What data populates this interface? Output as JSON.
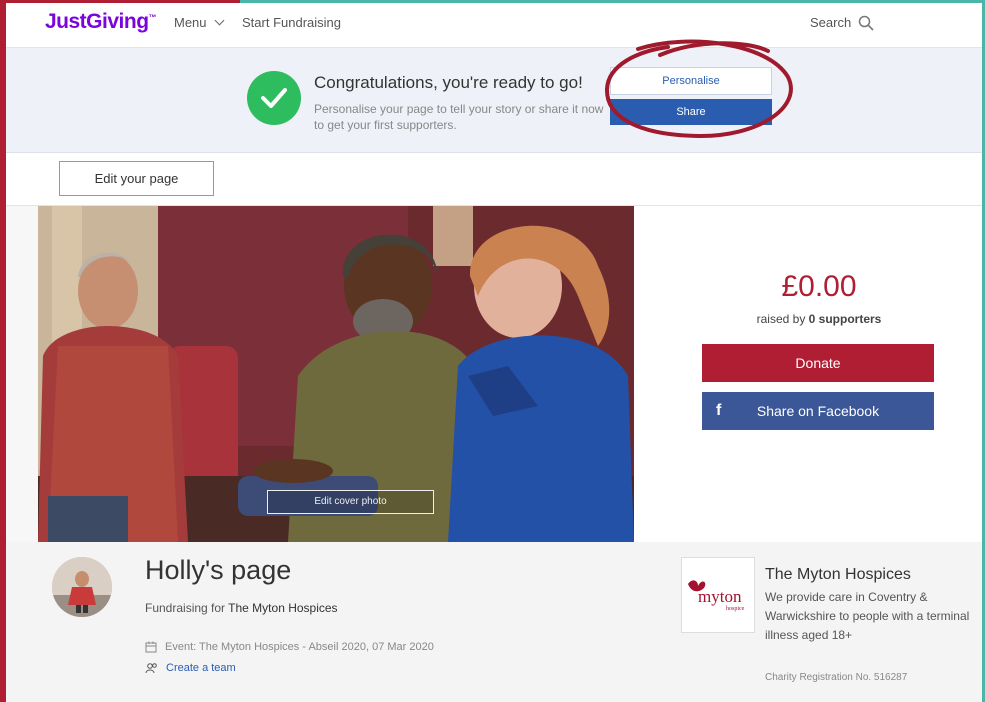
{
  "header": {
    "logo": "JustGiving",
    "menu_label": "Menu",
    "start_fundraising": "Start Fundraising",
    "search_label": "Search"
  },
  "banner": {
    "title": "Congratulations, you're ready to go!",
    "subtitle_line1": "Personalise your page to tell your story or share it now",
    "subtitle_line2": "to get your first supporters.",
    "personalise_label": "Personalise",
    "share_label": "Share"
  },
  "edit": {
    "edit_page_label": "Edit your page",
    "edit_cover_label": "Edit cover photo"
  },
  "fundraising": {
    "amount": "£0.00",
    "raised_by_prefix": "raised by",
    "supporters": "0 supporters",
    "donate_label": "Donate",
    "facebook_label": "Share on Facebook",
    "facebook_icon": "f"
  },
  "page": {
    "title": "Holly's page",
    "fundraising_for_prefix": "Fundraising for",
    "charity_link": "The Myton Hospices",
    "event": "Event: The Myton Hospices - Abseil 2020, 07 Mar 2020",
    "create_team": "Create a team"
  },
  "charity": {
    "name": "The Myton Hospices",
    "description": "We provide care in Coventry & Warwickshire to people with a terminal illness aged 18+",
    "registration": "Charity Registration No. 516287",
    "logo_text": "myton",
    "logo_subtext": "hospice"
  },
  "colors": {
    "brand_purple": "#7a04dd",
    "donate_red": "#b01e33",
    "facebook_blue": "#3b5797",
    "share_blue": "#2a5db0",
    "success_green": "#2dbd5f"
  }
}
